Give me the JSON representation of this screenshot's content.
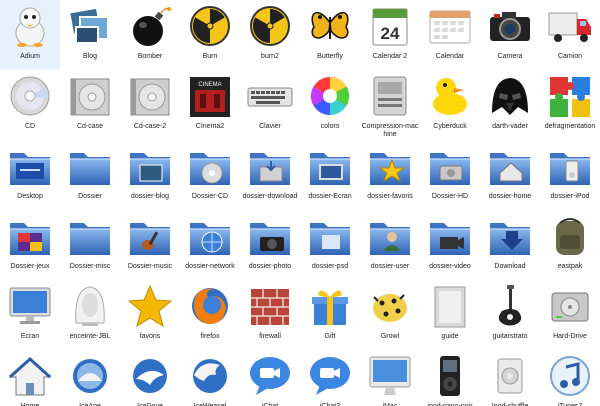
{
  "icons": [
    {
      "label": "Adium",
      "icon": "adium-duck-icon"
    },
    {
      "label": "Blog",
      "icon": "blog-photos-icon"
    },
    {
      "label": "Bomber",
      "icon": "bomb-icon"
    },
    {
      "label": "Burn",
      "icon": "radiation-icon"
    },
    {
      "label": "burn2",
      "icon": "radiation-icon"
    },
    {
      "label": "Butterfly",
      "icon": "butterfly-icon"
    },
    {
      "label": "Calendar 2",
      "icon": "calendar-24-icon",
      "text": "24"
    },
    {
      "label": "Calendar",
      "icon": "calendar-icon"
    },
    {
      "label": "Camera",
      "icon": "camera-icon"
    },
    {
      "label": "Camion",
      "icon": "truck-icon"
    },
    {
      "label": "CD",
      "icon": "cd-icon"
    },
    {
      "label": "Cd-case",
      "icon": "cd-case-icon"
    },
    {
      "label": "Cd-case-2",
      "icon": "cd-case-icon"
    },
    {
      "label": "CInema2",
      "icon": "cinema-icon",
      "text": "CINEMA"
    },
    {
      "label": "Clavier",
      "icon": "keyboard-icon"
    },
    {
      "label": "colors",
      "icon": "color-wheel-icon"
    },
    {
      "label": "Compression-machine",
      "icon": "compression-machine-icon"
    },
    {
      "label": "Cyberduck",
      "icon": "rubber-duck-icon"
    },
    {
      "label": "darth-vader",
      "icon": "darth-vader-icon"
    },
    {
      "label": "defragmentation",
      "icon": "puzzle-icon"
    },
    {
      "label": "Desktop",
      "icon": "desktop-folder-icon"
    },
    {
      "label": "Dossier",
      "icon": "folder-icon"
    },
    {
      "label": "dossier-blog",
      "icon": "folder-blog-icon"
    },
    {
      "label": "Dossier-CD",
      "icon": "folder-cd-icon"
    },
    {
      "label": "dossier-download",
      "icon": "folder-download-icon"
    },
    {
      "label": "dossier-Ecran",
      "icon": "folder-screen-icon"
    },
    {
      "label": "dossier-favoris",
      "icon": "folder-star-icon"
    },
    {
      "label": "Dossier-HD",
      "icon": "folder-hd-icon"
    },
    {
      "label": "dossier-home",
      "icon": "folder-home-icon"
    },
    {
      "label": "dossier-iPod",
      "icon": "folder-ipod-icon"
    },
    {
      "label": "Dossier-jeux",
      "icon": "folder-games-icon"
    },
    {
      "label": "Dossier-misc",
      "icon": "folder-misc-icon"
    },
    {
      "label": "Dossier-music",
      "icon": "folder-guitar-icon"
    },
    {
      "label": "dossier-network",
      "icon": "folder-network-icon"
    },
    {
      "label": "dossier-photo",
      "icon": "folder-camera-icon"
    },
    {
      "label": "dossier-psd",
      "icon": "folder-psd-icon"
    },
    {
      "label": "dossier-user",
      "icon": "folder-user-icon"
    },
    {
      "label": "dossier-video",
      "icon": "folder-video-icon"
    },
    {
      "label": "Download",
      "icon": "download-icon"
    },
    {
      "label": "eastpak",
      "icon": "backpack-icon"
    },
    {
      "label": "Ecran",
      "icon": "monitor-icon"
    },
    {
      "label": "enceinte-JBL",
      "icon": "speaker-icon"
    },
    {
      "label": "favoris",
      "icon": "star-icon"
    },
    {
      "label": "firefox",
      "icon": "firefox-icon"
    },
    {
      "label": "firewall",
      "icon": "firewall-icon"
    },
    {
      "label": "Gift",
      "icon": "gift-icon"
    },
    {
      "label": "Growl",
      "icon": "growl-icon"
    },
    {
      "label": "guide",
      "icon": "guide-icon"
    },
    {
      "label": "guitarstrato",
      "icon": "guitar-icon"
    },
    {
      "label": "Hard-Drive",
      "icon": "hard-drive-icon"
    },
    {
      "label": "Home",
      "icon": "home-icon"
    },
    {
      "label": "IceApe",
      "icon": "iceape-icon"
    },
    {
      "label": "IceDove",
      "icon": "icedove-icon"
    },
    {
      "label": "IceWeasel",
      "icon": "iceweasel-icon"
    },
    {
      "label": "iChat",
      "icon": "ichat-icon"
    },
    {
      "label": "iChat2",
      "icon": "ichat-icon"
    },
    {
      "label": "iMac",
      "icon": "imac-icon"
    },
    {
      "label": "ipod-nano-noir",
      "icon": "ipod-icon"
    },
    {
      "label": "Ipod-shuffle",
      "icon": "ipod-shuffle-icon"
    },
    {
      "label": "iTunes7",
      "icon": "itunes-icon"
    }
  ],
  "colors": {
    "folder": "#5b8fd6",
    "folderDark": "#3a6bb8",
    "yellow": "#f5c518",
    "red": "#d8262c"
  }
}
